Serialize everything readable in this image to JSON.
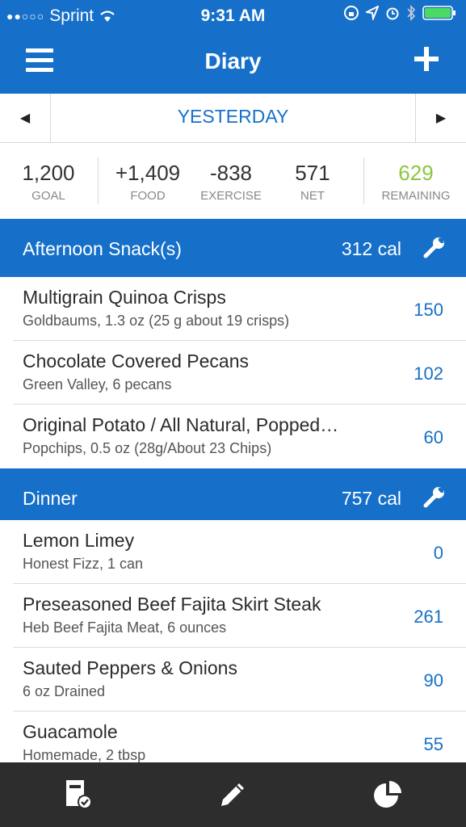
{
  "status": {
    "carrier": "Sprint",
    "signal_dots": "●●○○○",
    "time": "9:31 AM"
  },
  "header": {
    "title": "Diary"
  },
  "date_nav": {
    "label": "YESTERDAY",
    "prev": "◀",
    "next": "▶"
  },
  "summary": [
    {
      "value": "1,200",
      "label": "GOAL"
    },
    {
      "value": "+1,409",
      "label": "FOOD"
    },
    {
      "value": "-838",
      "label": "EXERCISE"
    },
    {
      "value": "571",
      "label": "NET"
    },
    {
      "value": "629",
      "label": "REMAINING"
    }
  ],
  "meals": [
    {
      "name": "Afternoon Snack(s)",
      "calories": "312 cal",
      "items": [
        {
          "name": "Multigrain Quinoa Crisps",
          "desc": "Goldbaums, 1.3 oz (25 g about 19 crisps)",
          "cal": "150"
        },
        {
          "name": "Chocolate Covered Pecans",
          "desc": "Green Valley, 6 pecans",
          "cal": "102"
        },
        {
          "name": "Original Potato / All Natural, Popped…",
          "desc": "Popchips, 0.5 oz (28g/About 23 Chips)",
          "cal": "60"
        }
      ]
    },
    {
      "name": "Dinner",
      "calories": "757 cal",
      "items": [
        {
          "name": "Lemon Limey",
          "desc": "Honest Fizz, 1 can",
          "cal": "0"
        },
        {
          "name": "Preseasoned Beef Fajita Skirt Steak",
          "desc": "Heb Beef Fajita Meat, 6 ounces",
          "cal": "261"
        },
        {
          "name": "Sauted Peppers & Onions",
          "desc": "6 oz Drained",
          "cal": "90"
        },
        {
          "name": "Guacamole",
          "desc": "Homemade, 2 tbsp",
          "cal": "55"
        }
      ]
    }
  ],
  "colors": {
    "brand": "#1670c9",
    "remaining": "#8cc63f",
    "tabbar": "#2d2d2d"
  }
}
